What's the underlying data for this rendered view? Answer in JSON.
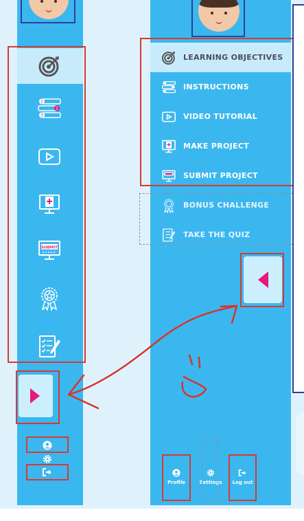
{
  "menu": {
    "items": [
      {
        "label": "LEARNING OBJECTIVES",
        "icon": "target-icon",
        "active": true
      },
      {
        "label": "INSTRUCTIONS",
        "icon": "instructions-list-icon",
        "active": false
      },
      {
        "label": "VIDEO TUTORIAL",
        "icon": "video-play-icon",
        "active": false
      },
      {
        "label": "MAKE PROJECT",
        "icon": "monitor-plus-icon",
        "active": false
      },
      {
        "label": "SUBMIT PROJECT",
        "icon": "submit-monitor-icon",
        "active": false
      },
      {
        "label": "BONUS CHALLENGE",
        "icon": "award-badge-icon",
        "active": false
      },
      {
        "label": "TAKE THE QUIZ",
        "icon": "quiz-checklist-icon",
        "active": false
      }
    ]
  },
  "left_icons": {
    "submit_text": "SUBMIT"
  },
  "instruction_badges": [
    "1",
    "2",
    "3"
  ],
  "toggles": {
    "expand": "expand-arrow-icon",
    "collapse": "collapse-arrow-icon"
  },
  "footer": {
    "profile_label": "Profile",
    "settings_label": "Settings",
    "logout_label": "Log out"
  },
  "colors": {
    "sidebar_blue": "#3bb7ef",
    "active_tile": "#c8ebfb",
    "accent_pink": "#e5197d",
    "annotation_red": "#d63a32",
    "frame_navy": "#2c3f9a"
  }
}
